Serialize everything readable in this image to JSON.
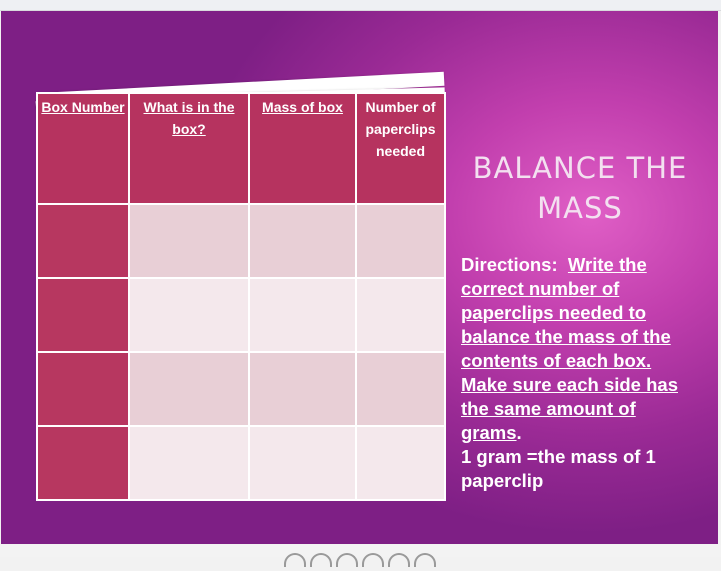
{
  "slide": {
    "title": "BALANCE THE MASS",
    "table": {
      "headers": [
        "Box Number",
        "What is in the box?",
        "Mass of box",
        "Number of paperclips needed"
      ],
      "rows": [
        [
          "",
          "",
          "",
          ""
        ],
        [
          "",
          "",
          "",
          ""
        ],
        [
          "",
          "",
          "",
          ""
        ],
        [
          "",
          "",
          "",
          ""
        ]
      ]
    },
    "directions": {
      "label": "Directions:",
      "instruction": "Write the correct number of paperclips needed to balance the mass of the contents of each box. Make sure each side has the same amount of grams",
      "period": ".",
      "note": "1 gram =the mass of 1 paperclip"
    }
  },
  "colors": {
    "header_bg": "#b6335f",
    "row_light": "#f4e8ec",
    "row_dark": "#e8cfd6",
    "slide_bg": "#9a2a95",
    "title_text": "#f3e0f0"
  },
  "carousel": {
    "dots": 6
  }
}
